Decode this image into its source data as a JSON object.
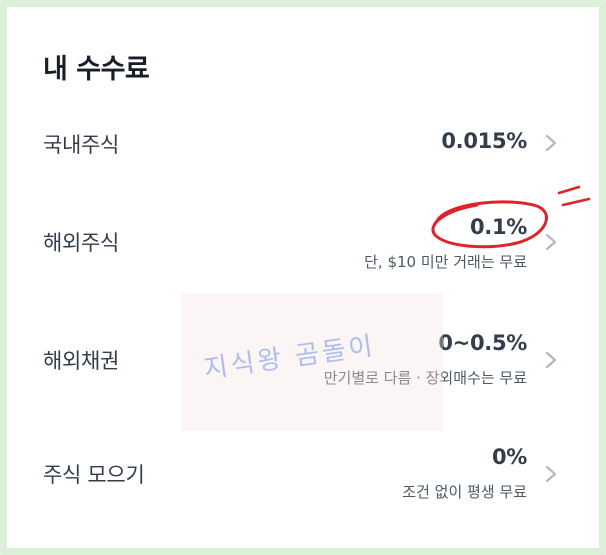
{
  "title": "내 수수료",
  "rows": [
    {
      "label": "국내주식",
      "value": "0.015%",
      "sub": ""
    },
    {
      "label": "해외주식",
      "value": "0.1%",
      "sub": "단, $10 미만 거래는 무료"
    },
    {
      "label": "해외채권",
      "value": "0~0.5%",
      "sub": "만기별로 다름 · 장외매수는 무료"
    },
    {
      "label": "주식 모으기",
      "value": "0%",
      "sub": "조건 없이 평생 무료"
    }
  ],
  "watermark": "지식왕 곰돌이",
  "colors": {
    "title": "#191f28",
    "text": "#333d4b",
    "subtext": "#4e5968",
    "chevron": "#b0b8c1",
    "frame": "#dcefd8",
    "annotation": "#e0222a"
  }
}
